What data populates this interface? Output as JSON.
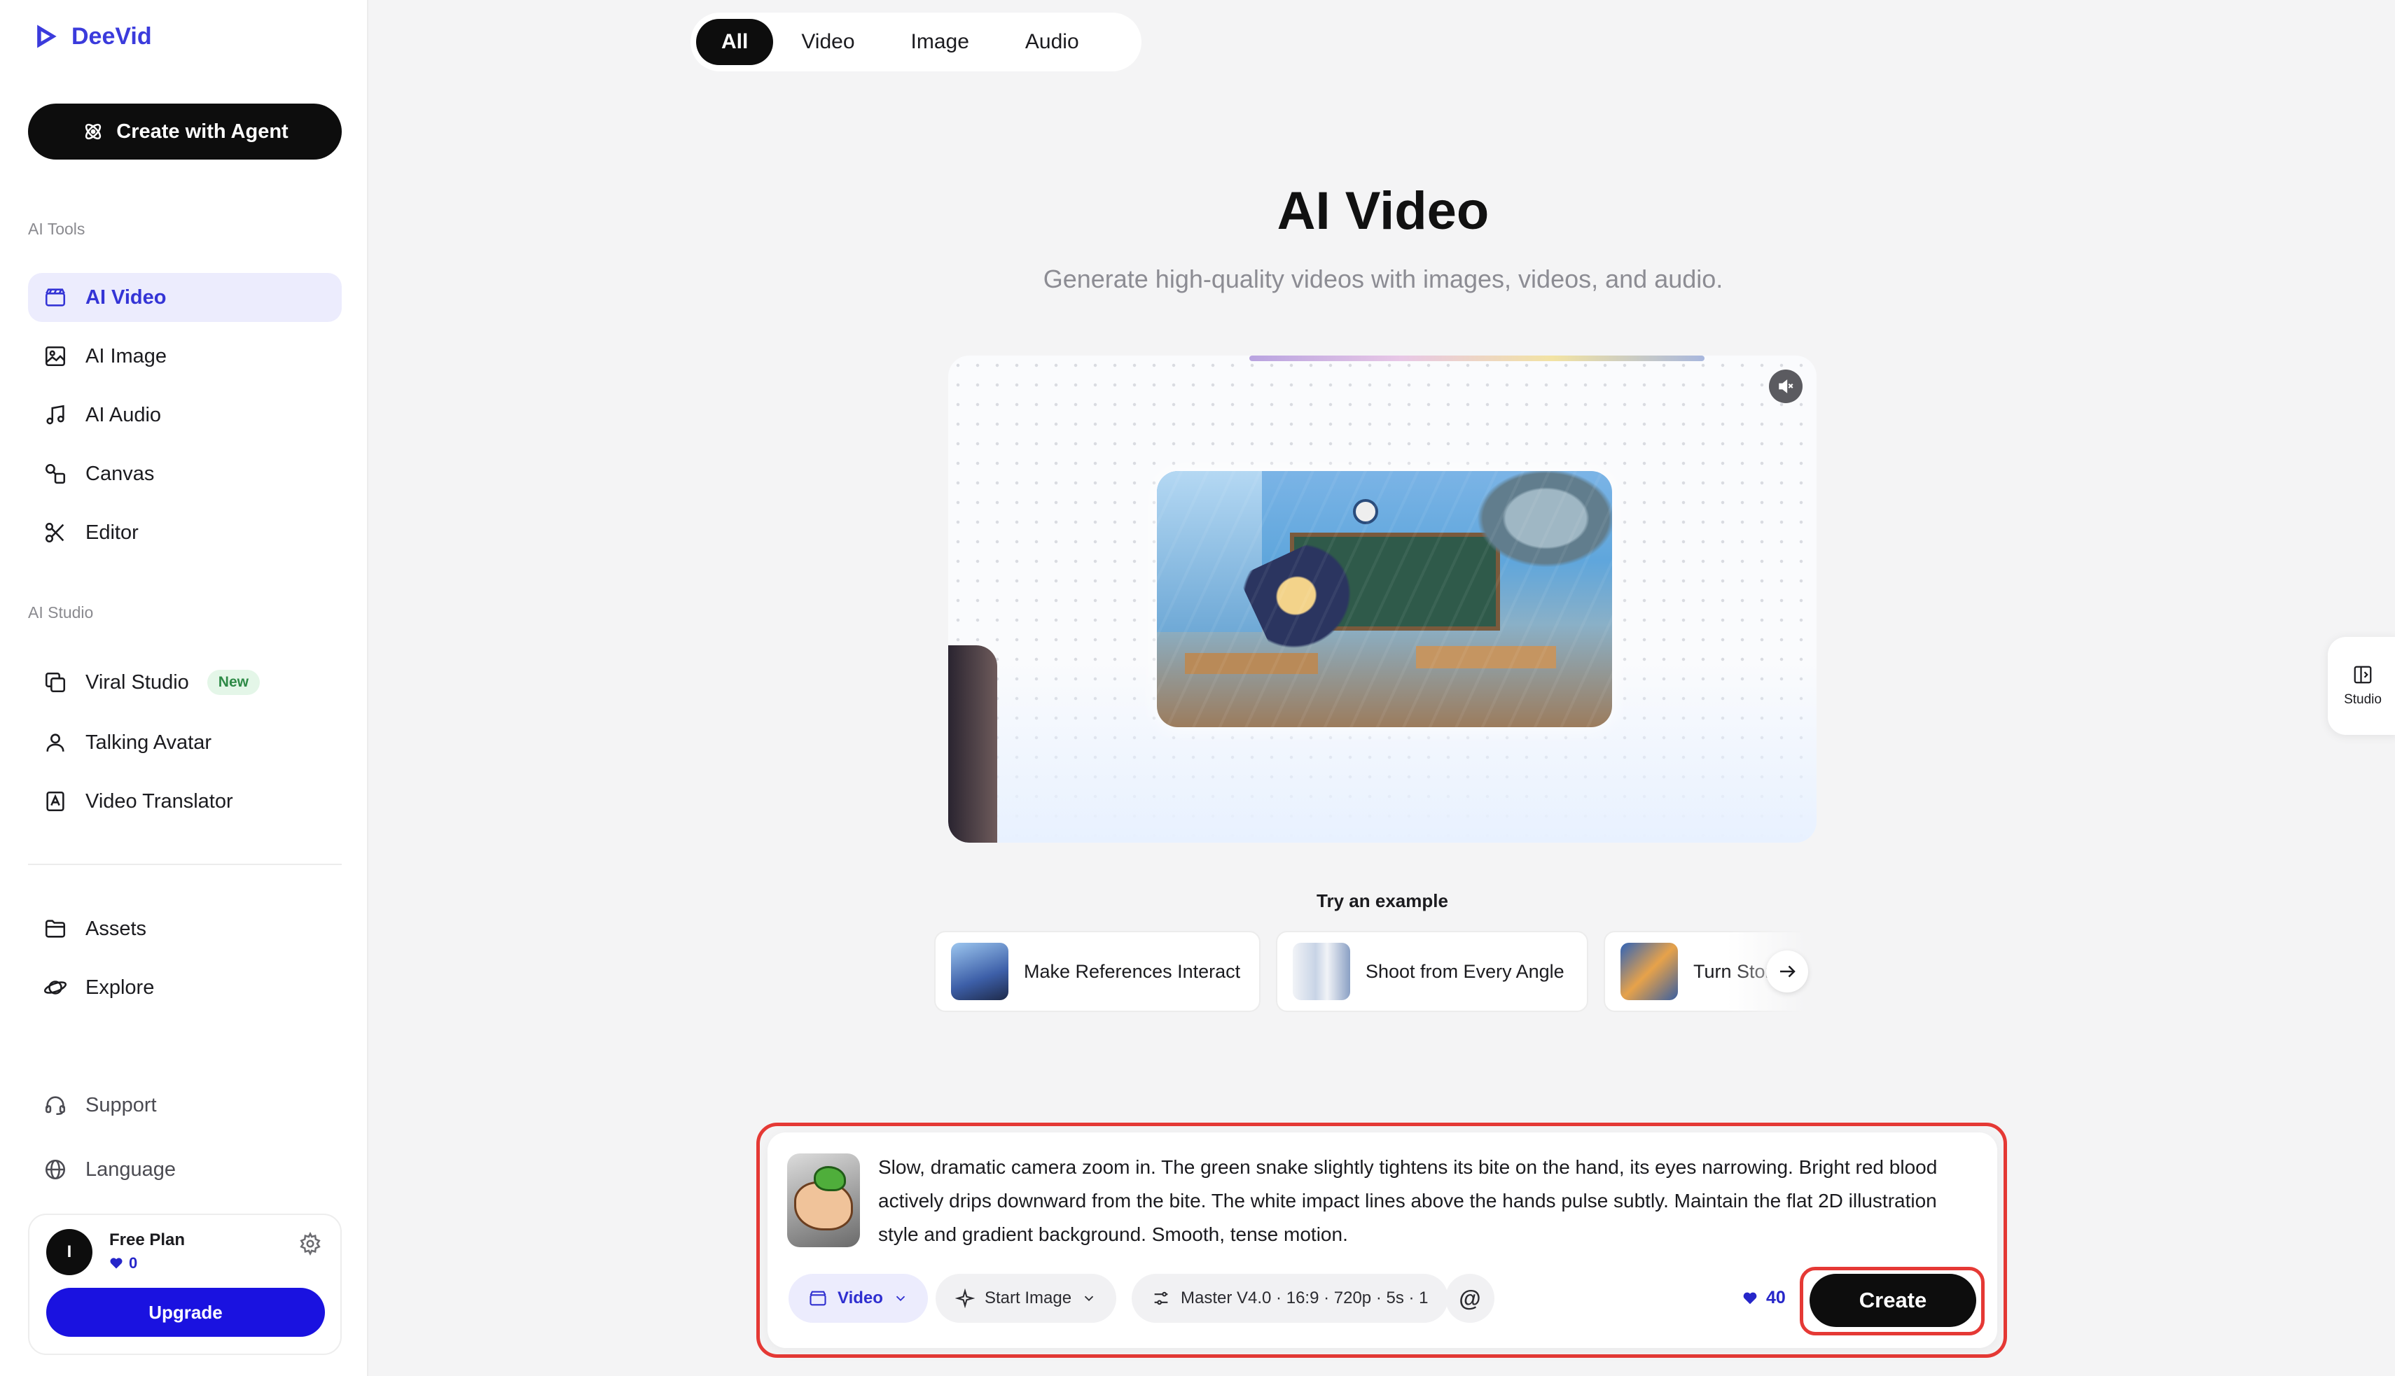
{
  "app": {
    "name": "DeeVid",
    "brand_color": "#3b3bdc"
  },
  "sidebar": {
    "agent_button": "Create with Agent",
    "tools_label": "AI Tools",
    "tools": [
      {
        "label": "AI Video",
        "icon": "clapperboard-icon",
        "active": true
      },
      {
        "label": "AI Image",
        "icon": "image-icon"
      },
      {
        "label": "AI Audio",
        "icon": "music-note-icon"
      },
      {
        "label": "Canvas",
        "icon": "shapes-icon"
      },
      {
        "label": "Editor",
        "icon": "scissors-icon"
      }
    ],
    "studio_label": "AI Studio",
    "studio": [
      {
        "label": "Viral Studio",
        "icon": "copy-icon",
        "badge": "New"
      },
      {
        "label": "Talking Avatar",
        "icon": "user-icon"
      },
      {
        "label": "Video Translator",
        "icon": "translate-icon"
      }
    ],
    "library": [
      {
        "label": "Assets",
        "icon": "folder-icon"
      },
      {
        "label": "Explore",
        "icon": "planet-icon"
      }
    ],
    "footer": [
      {
        "label": "Support",
        "icon": "headset-icon"
      },
      {
        "label": "Language",
        "icon": "globe-icon"
      }
    ],
    "plan": {
      "avatar_initial": "I",
      "name": "Free Plan",
      "credits": "0",
      "upgrade": "Upgrade"
    }
  },
  "tabs": [
    {
      "label": "All",
      "active": true
    },
    {
      "label": "Video"
    },
    {
      "label": "Image"
    },
    {
      "label": "Audio"
    }
  ],
  "hero": {
    "title": "AI Video",
    "subtitle": "Generate high-quality videos with images, videos, and audio."
  },
  "examples": {
    "label": "Try an example",
    "items": [
      {
        "label": "Make References Interact"
      },
      {
        "label": "Shoot from Every Angle"
      },
      {
        "label": "Turn Storyboard"
      }
    ]
  },
  "studio_toggle": {
    "label": "Studio"
  },
  "composer": {
    "prompt": "Slow, dramatic camera zoom in. The green snake slightly tightens its bite on the hand, its eyes narrowing. Bright red blood actively drips downward from the bite. The white impact lines above the hands pulse subtly. Maintain the flat 2D illustration style and gradient background. Smooth, tense motion.",
    "mode": "Video",
    "start_image": "Start Image",
    "settings": "Master V4.0 · 16:9 · 720p · 5s · 1",
    "mention": "@",
    "cost": "40",
    "create": "Create"
  },
  "colors": {
    "highlight_outline": "#e53935",
    "accent_blue": "#1a12e0"
  }
}
